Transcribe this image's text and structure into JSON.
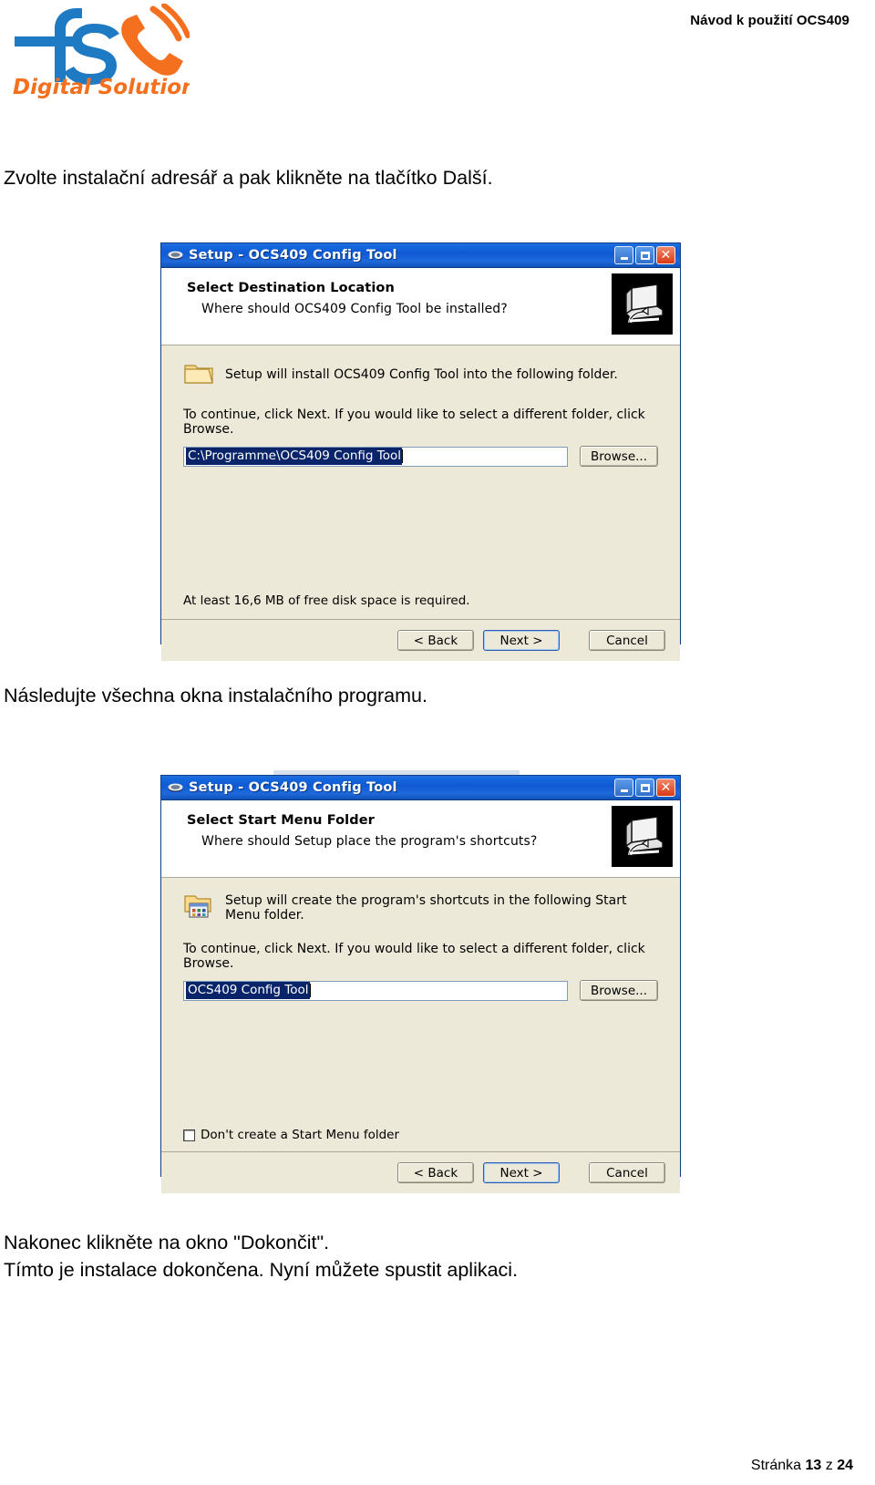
{
  "header": {
    "doc_title": "Návod k použití OCS409",
    "logo": {
      "mark_text": "fs",
      "tagline": "Digital Solutions",
      "blue": "#1f7ac4",
      "orange": "#f4701f"
    }
  },
  "paragraphs": {
    "p1": "Zvolte instalační adresář a pak klikněte na tlačítko Další.",
    "p2": "Následujte všechna okna instalačního programu.",
    "p3": "Nakonec klikněte na okno \"Dokončit\".",
    "p4": "Tímto je instalace dokončena. Nyní můžete spustit aplikaci."
  },
  "setup_dialog_1": {
    "title": "Setup - OCS409 Config Tool",
    "titlebar_icon": "setup-box-icon",
    "minimize": "_",
    "maximize": "□",
    "close": "✕",
    "heading": "Select Destination Location",
    "subheading": "Where should OCS409 Config Tool be installed?",
    "header_icon": "monitor-install-icon",
    "body_icon": "folder-icon",
    "body_line1": "Setup will install OCS409 Config Tool into the following folder.",
    "body_line2": "To continue, click Next. If you would like to select a different folder, click Browse.",
    "path_value": "C:\\Programme\\OCS409 Config Tool",
    "browse_label": "Browse...",
    "disk_note": "At least 16,6 MB of free disk space is required.",
    "back_label": "< Back",
    "next_label": "Next >",
    "cancel_label": "Cancel"
  },
  "setup_dialog_2": {
    "title": "Setup - OCS409 Config Tool",
    "titlebar_icon": "setup-box-icon",
    "minimize": "_",
    "maximize": "□",
    "close": "✕",
    "heading": "Select Start Menu Folder",
    "subheading": "Where should Setup place the program's shortcuts?",
    "header_icon": "monitor-install-icon",
    "body_icon": "folder-shortcuts-icon",
    "body_line1": "Setup will create the program's shortcuts in the following Start Menu folder.",
    "body_line2": "To continue, click Next. If you would like to select a different folder, click Browse.",
    "folder_value": "OCS409 Config Tool",
    "browse_label": "Browse...",
    "checkbox_label": "Don't create a Start Menu folder",
    "checkbox_checked": false,
    "back_label": "< Back",
    "next_label": "Next >",
    "cancel_label": "Cancel"
  },
  "footer": {
    "prefix": "Stránka ",
    "page": "13",
    "middle": " z ",
    "total": "24"
  }
}
